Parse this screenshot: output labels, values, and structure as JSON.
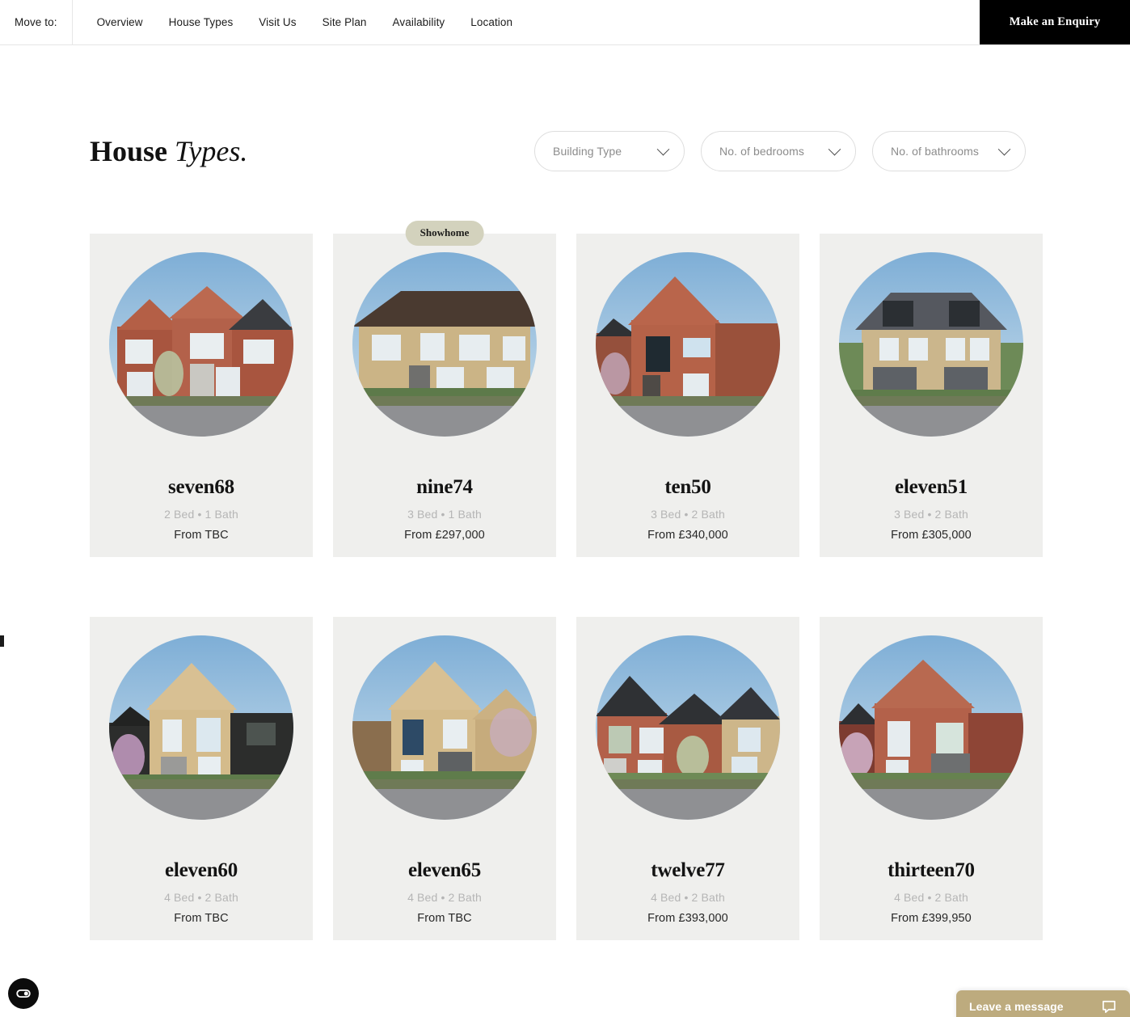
{
  "nav": {
    "move_to_label": "Move to:",
    "links": [
      {
        "label": "Overview"
      },
      {
        "label": "House Types"
      },
      {
        "label": "Visit Us"
      },
      {
        "label": "Site Plan"
      },
      {
        "label": "Availability"
      },
      {
        "label": "Location"
      }
    ],
    "enquiry_label": "Make an Enquiry"
  },
  "header": {
    "title_bold": "House ",
    "title_italic": "Types."
  },
  "filters": [
    {
      "label": "Building Type",
      "icon": "chevron-down-icon"
    },
    {
      "label": "No. of bedrooms",
      "icon": "chevron-down-icon"
    },
    {
      "label": "No. of bathrooms",
      "icon": "chevron-down-icon"
    }
  ],
  "colors": {
    "card_background": "#efefed",
    "badge_background": "#d3d2bd",
    "enquiry_button": "#000000",
    "chat_background": "#bdab7e",
    "spec_text": "#b5b5b5"
  },
  "cards": [
    {
      "name": "seven68",
      "spec": "2 Bed  •  1 Bath",
      "price": "From TBC",
      "badge": null,
      "style": "red-pair"
    },
    {
      "name": "nine74",
      "spec": "3 Bed  •  1 Bath",
      "price": "From £297,000",
      "badge": "Showhome",
      "style": "buff-pair"
    },
    {
      "name": "ten50",
      "spec": "3 Bed  •  2 Bath",
      "price": "From £340,000",
      "badge": null,
      "style": "red-gable"
    },
    {
      "name": "eleven51",
      "spec": "3 Bed  •  2 Bath",
      "price": "From £305,000",
      "badge": null,
      "style": "buff-town"
    },
    {
      "name": "eleven60",
      "spec": "4 Bed  •  2 Bath",
      "price": "From TBC",
      "badge": null,
      "style": "buff-black"
    },
    {
      "name": "eleven65",
      "spec": "4 Bed  •  2 Bath",
      "price": "From TBC",
      "badge": null,
      "style": "buff-gable"
    },
    {
      "name": "twelve77",
      "spec": "4 Bed  •  2 Bath",
      "price": "From £393,000",
      "badge": null,
      "style": "mixed-pair"
    },
    {
      "name": "thirteen70",
      "spec": "4 Bed  •  2 Bath",
      "price": "From £399,950",
      "badge": null,
      "style": "red-tall"
    }
  ],
  "widgets": {
    "accessibility_icon": "accessibility-toggle-icon",
    "chat_label": "Leave a message",
    "chat_icon": "chat-bubble-icon"
  }
}
